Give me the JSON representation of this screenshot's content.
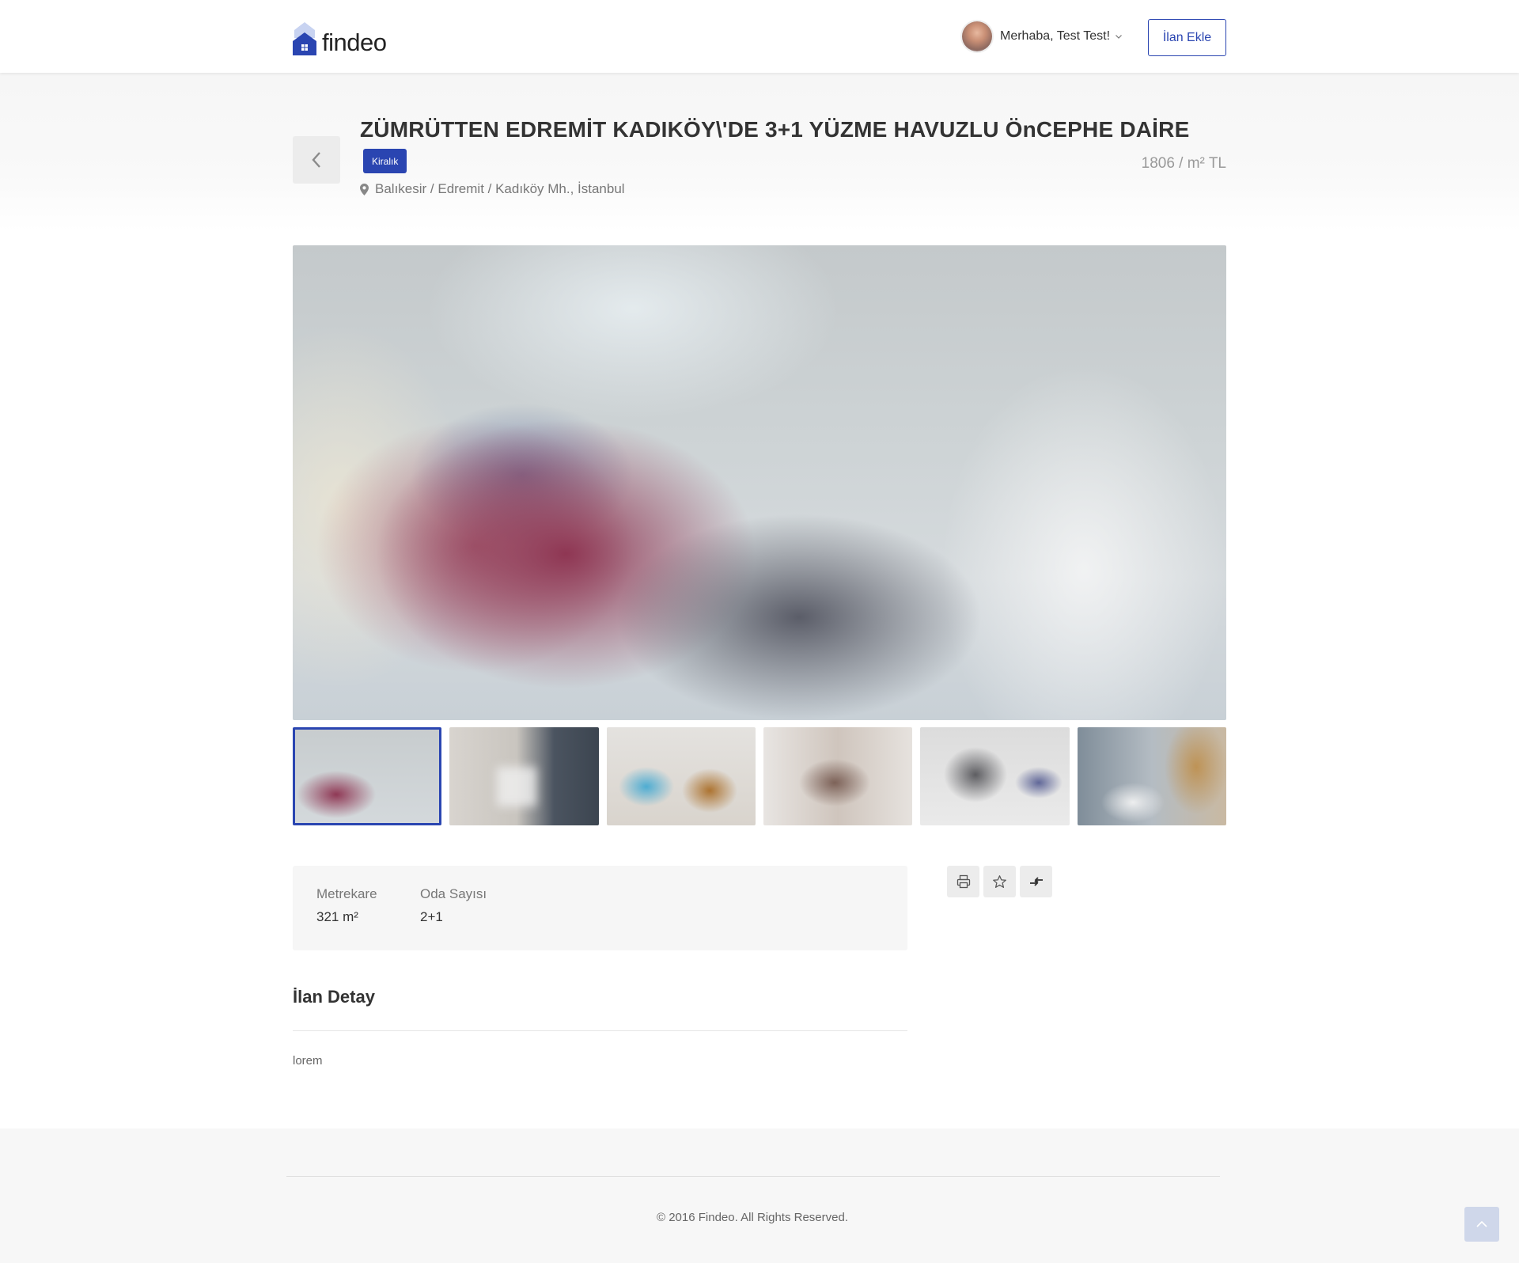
{
  "header": {
    "logo_text": "findeo",
    "greeting": "Merhaba, Test Test!",
    "add_listing_label": "İlan Ekle"
  },
  "listing": {
    "title": "ZÜMRÜTTEN EDREMİT KADIKÖY\\'DE 3+1 YÜZME HAVUZLU ÖnCEPHE DAİRE",
    "badge": "Kiralık",
    "location": "Balıkesir / Edremit / Kadıköy Mh., İstanbul",
    "price": "1806 / m² TL"
  },
  "gallery": {
    "thumbnail_count": 6,
    "active_index": 0
  },
  "features": [
    {
      "label": "Metrekare",
      "value": "321 m²"
    },
    {
      "label": "Oda Sayısı",
      "value": "2+1"
    }
  ],
  "actions": {
    "print": "print-icon",
    "favorite": "star-icon",
    "compare": "compare-icon"
  },
  "detail": {
    "title": "İlan Detay",
    "body": "lorem"
  },
  "footer": {
    "copyright": "© 2016 Findeo. All Rights Reserved."
  },
  "colors": {
    "accent": "#2a45b1",
    "panel": "#f6f6f6"
  }
}
